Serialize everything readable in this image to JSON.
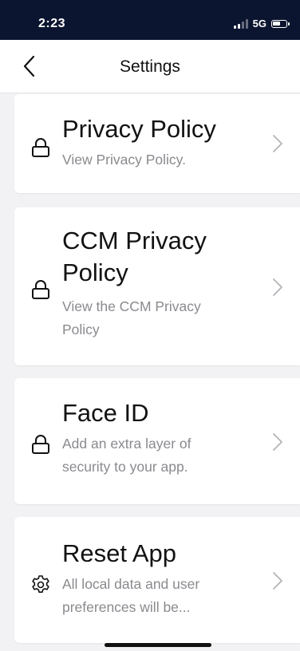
{
  "status_bar": {
    "time": "2:23",
    "network": "5G",
    "signal_bars_active": 2,
    "signal_bars_total": 4,
    "battery_level": 0.6
  },
  "nav": {
    "title": "Settings",
    "back_icon": "chevron-left-icon"
  },
  "cards": [
    {
      "title": "Privacy Policy",
      "description": "View Privacy Policy.",
      "icon": "lock-icon"
    },
    {
      "title": "CCM Privacy Policy",
      "description": "View the CCM Privacy Policy",
      "icon": "lock-icon"
    },
    {
      "title": "Face ID",
      "description": "Add an extra layer of security to your app.",
      "icon": "lock-icon"
    },
    {
      "title": "Reset App",
      "description": "All local data and user preferences will be...",
      "icon": "gear-icon"
    }
  ],
  "colors": {
    "status_bar_bg": "#0c1530",
    "page_bg": "#f2f2f4",
    "card_bg": "#ffffff",
    "title_text": "#121212",
    "secondary_text": "#8a8a8f"
  }
}
